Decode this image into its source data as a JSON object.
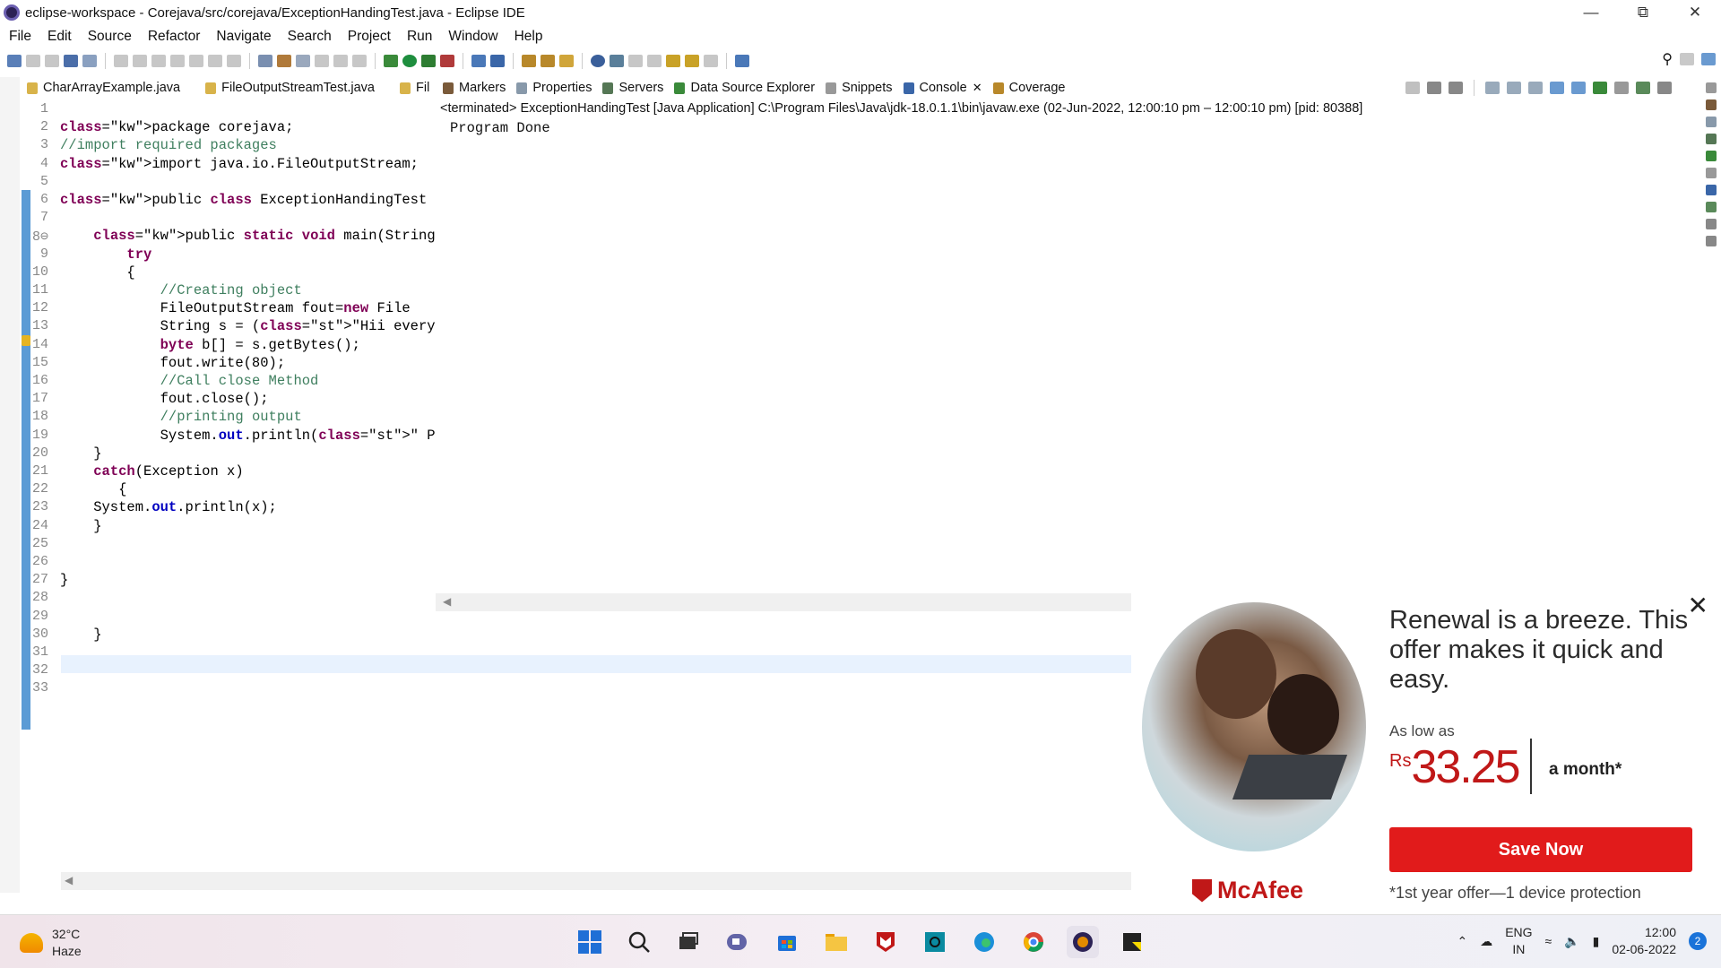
{
  "window": {
    "title": "eclipse-workspace - Corejava/src/corejava/ExceptionHandingTest.java - Eclipse IDE",
    "min": "—",
    "max": "⧉",
    "close": "✕"
  },
  "menu": [
    "File",
    "Edit",
    "Source",
    "Refactor",
    "Navigate",
    "Search",
    "Project",
    "Run",
    "Window",
    "Help"
  ],
  "editor_tabs": [
    "CharArrayExample.java",
    "FileOutputStreamTest.java",
    "Fil"
  ],
  "view_tabs": [
    "Markers",
    "Properties",
    "Servers",
    "Data Source Explorer",
    "Snippets",
    "Console",
    "Coverage"
  ],
  "console_close": "✕",
  "console": {
    "path": "<terminated> ExceptionHandingTest [Java Application] C:\\Program Files\\Java\\jdk-18.0.1.1\\bin\\javaw.exe  (02-Jun-2022, 12:00:10 pm – 12:00:10 pm) [pid: 80388]",
    "output": "Program Done"
  },
  "code": {
    "line_numbers": [
      "1",
      "2",
      "3",
      "4",
      "5",
      "6",
      "7",
      "8⊖",
      "9",
      "10",
      "11",
      "12",
      "13",
      "14",
      "15",
      "16",
      "17",
      "18",
      "19",
      "20",
      "21",
      "22",
      "23",
      "24",
      "25",
      "26",
      "27",
      "28",
      "29",
      "30",
      "31",
      "32",
      "33"
    ],
    "lines": [
      "",
      "package corejava;",
      "//import required packages",
      "import java.io.FileOutputStream;",
      "",
      "public class ExceptionHandingTest {",
      "",
      "    public static void main(String[] args)",
      "        try",
      "        {",
      "            //Creating object",
      "            FileOutputStream fout=new File",
      "            String s = (\"Hii everyone\");",
      "            byte b[] = s.getBytes();",
      "            fout.write(80);",
      "            //Call close Method",
      "            fout.close();",
      "            //printing output",
      "            System.out.println(\" Program D",
      "    }",
      "    catch(Exception x)",
      "       {",
      "    System.out.println(x);",
      "    }",
      "",
      "",
      "}",
      "",
      "",
      "    }",
      "",
      "",
      ""
    ]
  },
  "ad": {
    "close": "✕",
    "headline": "Renewal is a breeze. This offer makes it quick and easy.",
    "as_low_as": "As low as",
    "currency": "Rs",
    "price": "33.25",
    "period": "a month*",
    "button": "Save Now",
    "footnote": "*1st year offer—1 device protection",
    "brand": "McAfee"
  },
  "taskbar": {
    "temp": "32°C",
    "condition": "Haze",
    "lang1": "ENG",
    "lang2": "IN",
    "time": "12:00",
    "date": "02-06-2022",
    "notifications": "2"
  }
}
